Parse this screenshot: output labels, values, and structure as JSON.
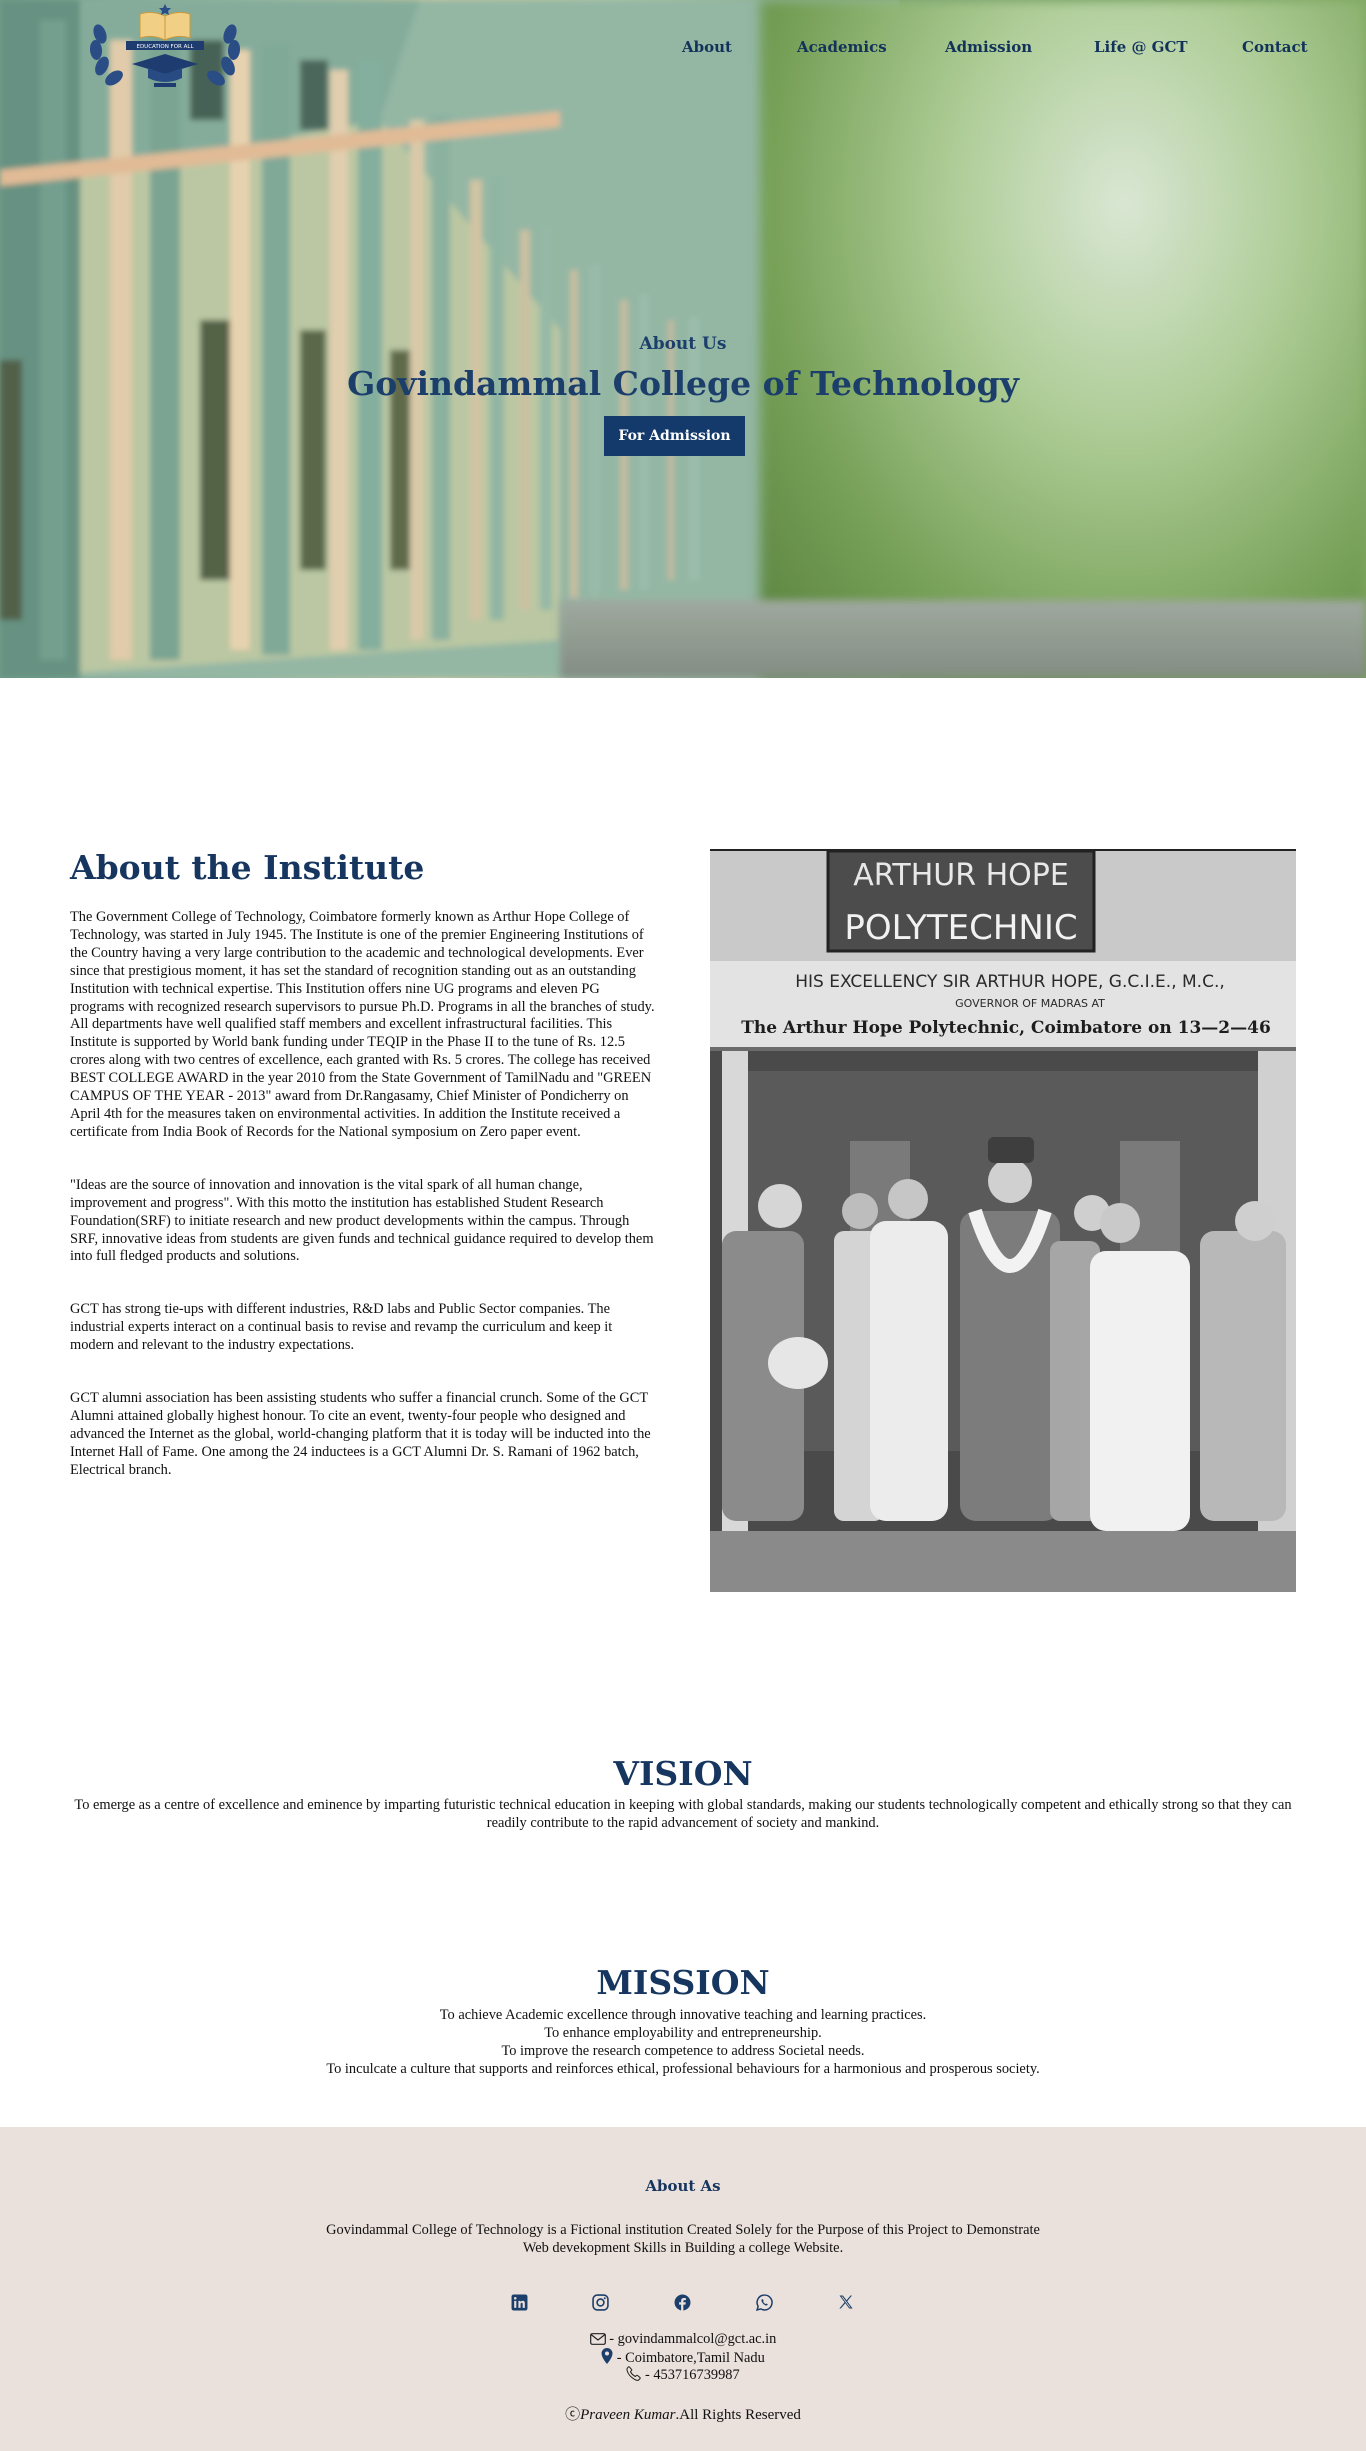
{
  "nav": {
    "logo_text": "EDUCATION FOR ALL",
    "links": [
      "About",
      "Academics",
      "Admission",
      "Life @ GCT",
      "Contact"
    ]
  },
  "hero": {
    "kicker": "About Us",
    "title": "Govindammal College of Technology",
    "button": "For Admission"
  },
  "about": {
    "heading": "About the Institute",
    "paragraphs": [
      "The Government College of Technology, Coimbatore formerly known as Arthur Hope College of Technology, was started in July 1945. The Institute is one of the premier Engineering Institutions of the Country having a very large contribution to the academic and technological developments. Ever since that prestigious moment, it has set the standard of recognition standing out as an outstanding Institution with technical expertise. This Institution offers nine UG programs and eleven PG programs with recognized research supervisors to pursue Ph.D. Programs in all the branches of study. All departments have well qualified staff members and excellent infrastructural facilities. This Institute is supported by World bank funding under TEQIP in the Phase II to the tune of Rs. 12.5 crores along with two centres of excellence, each granted with Rs. 5 crores. The college has received BEST COLLEGE AWARD in the year 2010 from the State Government of TamilNadu and \"GREEN CAMPUS OF THE YEAR - 2013\" award from Dr.Rangasamy, Chief Minister of Pondicherry on April 4th for the measures taken on environmental activities. In addition the Institute received a certificate from India Book of Records for the National symposium on Zero paper event.",
      "\"Ideas are the source of innovation and innovation is the vital spark of all human change, improvement and progress\". With this motto the institution has established Student Research Foundation(SRF) to initiate research and new product developments within the campus. Through SRF, innovative ideas from students are given funds and technical guidance required to develop them into full fledged products and solutions.",
      "GCT has strong tie-ups with different industries, R&D labs and Public Sector companies. The industrial experts interact on a continual basis to revise and revamp the curriculum and keep it modern and relevant to the industry expectations.",
      "GCT alumni association has been assisting students who suffer a financial crunch. Some of the GCT Alumni attained globally highest honour. To cite an event, twenty-four people who designed and advanced the Internet as the global, world-changing platform that it is today will be inducted into the Internet Hall of Fame. One among the 24 inductees is a GCT Alumni Dr. S. Ramani of 1962 batch, Electrical branch."
    ],
    "photo": {
      "sign_top": "ARTHUR HOPE",
      "sign_main": "POLYTECHNIC",
      "banner": "HIS EXCELLENCY SIR ARTHUR HOPE, G.C.I.E., M.C.,",
      "banner_sub": "GOVERNOR OF MADRAS AT",
      "caption": "The Arthur Hope Polytechnic, Coimbatore on 13—2—46"
    }
  },
  "vision": {
    "heading": "VISION",
    "text": "To emerge as a centre of excellence and eminence by imparting futuristic technical education in keeping with global standards, making our students technologically competent and ethically strong so that they can readily contribute to the rapid advancement of society and mankind."
  },
  "mission": {
    "heading": "MISSION",
    "lines": [
      "To achieve Academic excellence through innovative teaching and learning practices.",
      "To enhance employability and entrepreneurship.",
      "To improve the research competence to address Societal needs.",
      "To inculcate a culture that supports and reinforces ethical, professional behaviours for a harmonious and prosperous society."
    ]
  },
  "footer": {
    "title": "About As",
    "description": "Govindammal College of Technology is a Fictional institution Created Solely for the Purpose of this Project to Demonstrate Web devekopment Skills in Building a college Website.",
    "socials": [
      "linkedin-icon",
      "instagram-icon",
      "facebook-icon",
      "whatsapp-icon",
      "x-icon"
    ],
    "email": "- govindammalcol@gct.ac.in",
    "address": "- Coimbatore,Tamil Nadu",
    "phone": "- 453716739987",
    "copyright_symbol": "ⓒ",
    "author": "Praveen Kumar",
    "rights": ".All Rights Reserved"
  },
  "colors": {
    "brand": "#16365f",
    "button": "#143a6b",
    "footer_bg": "#ebe1dc"
  }
}
